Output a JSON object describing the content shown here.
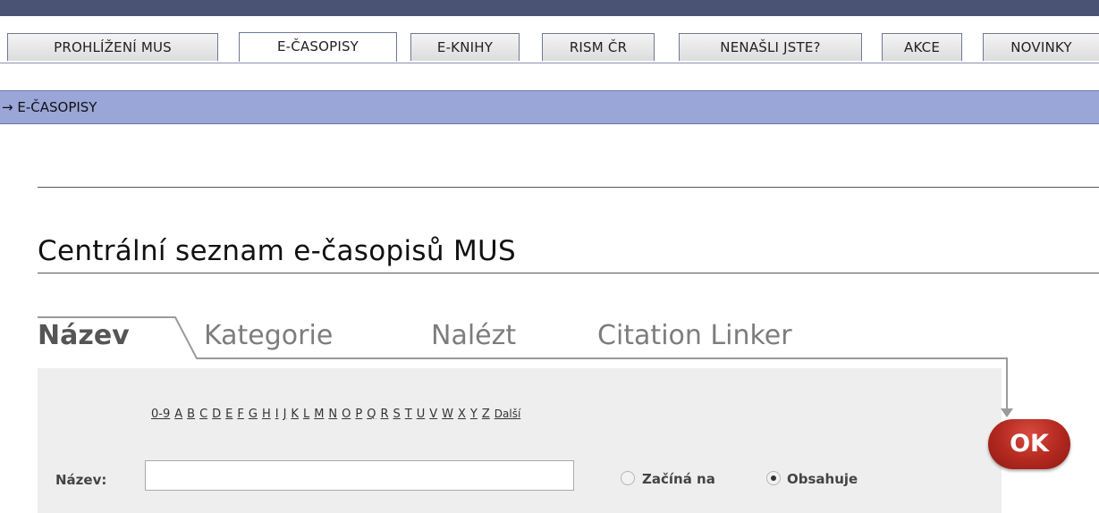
{
  "nav": {
    "tabs": [
      {
        "label": "PROHLÍŽENÍ MUS"
      },
      {
        "label": "E-ČASOPISY"
      },
      {
        "label": "E-KNIHY"
      },
      {
        "label": "RISM ČR"
      },
      {
        "label": "NENAŠLI JSTE?"
      },
      {
        "label": "AKCE"
      },
      {
        "label": "NOVINKY"
      }
    ],
    "active_tab": "E-ČASOPISY"
  },
  "breadcrumb": {
    "arrow": "→",
    "label": "E-ČASOPISY"
  },
  "page_title": "Centrální seznam e-časopisů MUS",
  "search_tabs": [
    {
      "label": "Název"
    },
    {
      "label": "Kategorie"
    },
    {
      "label": "Nalézt"
    },
    {
      "label": "Citation Linker"
    }
  ],
  "letters": [
    "0-9",
    "A",
    "B",
    "C",
    "D",
    "E",
    "F",
    "G",
    "H",
    "I",
    "J",
    "K",
    "L",
    "M",
    "N",
    "O",
    "P",
    "Q",
    "R",
    "S",
    "T",
    "U",
    "V",
    "W",
    "X",
    "Y",
    "Z"
  ],
  "letters_more": "Další",
  "search": {
    "label": "Název:",
    "value": "",
    "placeholder": "",
    "options": [
      {
        "label": "Začíná na",
        "selected": false
      },
      {
        "label": "Obsahuje",
        "selected": true
      }
    ]
  },
  "ok_button": "OK",
  "colors": {
    "topbar": "#4a5372",
    "breadcrumb_bar": "#9aa6d8",
    "ok_button": "#b2281f",
    "panel": "#eeeeee"
  }
}
